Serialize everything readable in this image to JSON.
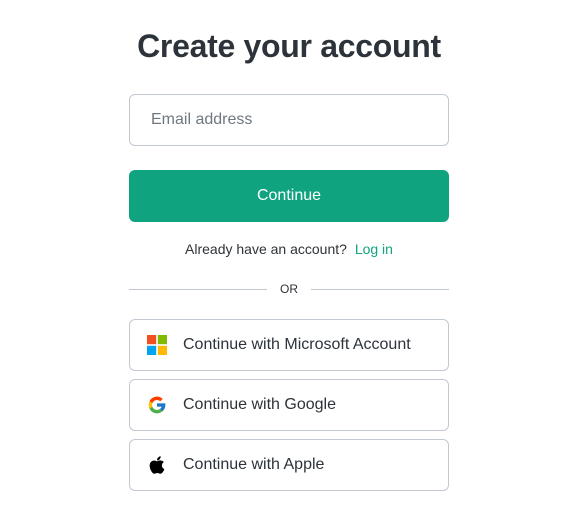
{
  "page": {
    "title": "Create your account"
  },
  "form": {
    "email_placeholder": "Email address",
    "email_value": "",
    "continue_label": "Continue"
  },
  "login_prompt": {
    "text": "Already have an account?",
    "link_label": "Log in"
  },
  "divider": {
    "text": "OR"
  },
  "social": [
    {
      "label": "Continue with Microsoft Account",
      "icon": "microsoft-icon"
    },
    {
      "label": "Continue with Google",
      "icon": "google-icon"
    },
    {
      "label": "Continue with Apple",
      "icon": "apple-icon"
    }
  ],
  "colors": {
    "accent": "#10a37f",
    "text": "#2d333a",
    "border": "#c2c8d0"
  }
}
